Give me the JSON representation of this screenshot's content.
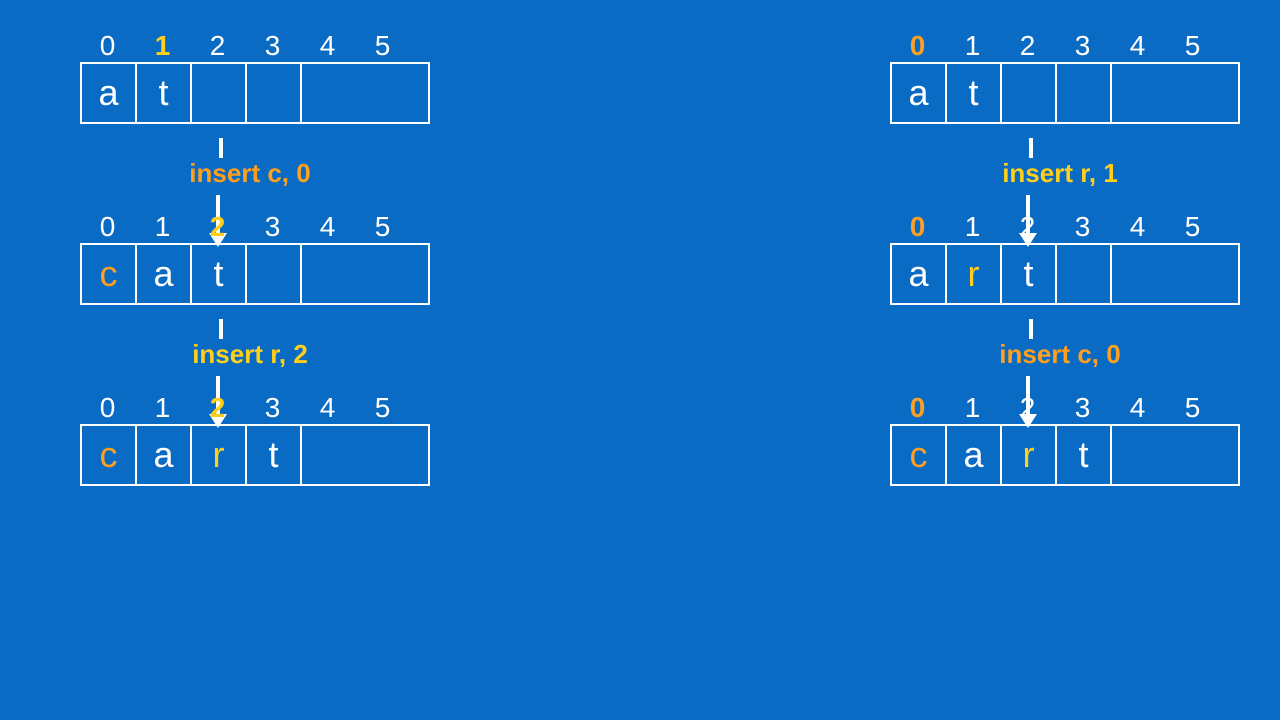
{
  "colors": {
    "background": "#0a6bc4",
    "highlight_yellow": "#ffcf1a",
    "highlight_orange": "#ff9f1e",
    "cell_border": "#ffffff"
  },
  "cell_count": 5,
  "columns": {
    "left": {
      "states": [
        {
          "indices": [
            "0",
            "1",
            "2",
            "3",
            "4",
            "5"
          ],
          "index_highlight": {
            "1": "yellow"
          },
          "cells": [
            "a",
            "t",
            "",
            "",
            ""
          ],
          "cell_colors": {}
        },
        {
          "indices": [
            "0",
            "1",
            "2",
            "3",
            "4",
            "5"
          ],
          "index_highlight": {
            "2": "yellow"
          },
          "cells": [
            "c",
            "a",
            "t",
            "",
            ""
          ],
          "cell_colors": {
            "0": "orange"
          }
        },
        {
          "indices": [
            "0",
            "1",
            "2",
            "3",
            "4",
            "5"
          ],
          "index_highlight": {
            "2": "yellow"
          },
          "cells": [
            "c",
            "a",
            "r",
            "t",
            ""
          ],
          "cell_colors": {
            "0": "orange",
            "2": "yellow"
          }
        }
      ],
      "ops": [
        {
          "label": "insert c, 0",
          "color": "orange"
        },
        {
          "label": "insert r, 2",
          "color": "yellow"
        }
      ]
    },
    "right": {
      "states": [
        {
          "indices": [
            "0",
            "1",
            "2",
            "3",
            "4",
            "5"
          ],
          "index_highlight": {
            "0": "orange"
          },
          "cells": [
            "a",
            "t",
            "",
            "",
            ""
          ],
          "cell_colors": {}
        },
        {
          "indices": [
            "0",
            "1",
            "2",
            "3",
            "4",
            "5"
          ],
          "index_highlight": {
            "0": "orange"
          },
          "cells": [
            "a",
            "r",
            "t",
            "",
            ""
          ],
          "cell_colors": {
            "1": "yellow"
          }
        },
        {
          "indices": [
            "0",
            "1",
            "2",
            "3",
            "4",
            "5"
          ],
          "index_highlight": {
            "0": "orange"
          },
          "cells": [
            "c",
            "a",
            "r",
            "t",
            ""
          ],
          "cell_colors": {
            "0": "orange",
            "2": "yellow"
          }
        }
      ],
      "ops": [
        {
          "label": "insert r, 1",
          "color": "yellow"
        },
        {
          "label": "insert c, 0",
          "color": "orange"
        }
      ]
    }
  }
}
